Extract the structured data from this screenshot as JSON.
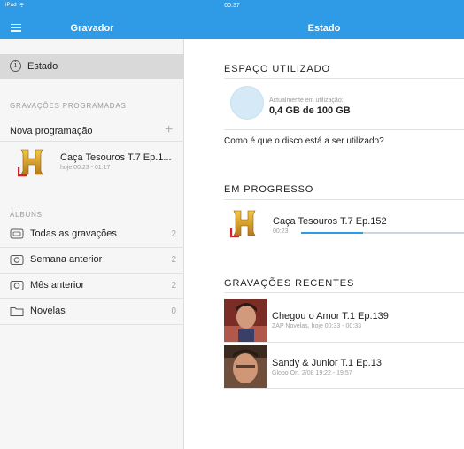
{
  "status_bar": {
    "device": "iPad",
    "wifi": "wifi-icon",
    "time": "00:37"
  },
  "nav": {
    "left_title": "Gravador",
    "right_title": "Estado",
    "accent": "#2f9ae6"
  },
  "sidebar": {
    "selected_label": "Estado",
    "scheduled_header": "GRAVAÇÕES PROGRAMADAS",
    "new_schedule_label": "Nova programação",
    "scheduled": [
      {
        "title": "Caça Tesouros T.7 Ep.1...",
        "time": "hoje 00:23 - 01:17",
        "icon": "history-channel-logo"
      }
    ],
    "albums_header": "ÁLBUNS",
    "albums": [
      {
        "label": "Todas as gravações",
        "count": "2",
        "icon": "tv-icon"
      },
      {
        "label": "Semana anterior",
        "count": "2",
        "icon": "camera-icon"
      },
      {
        "label": "Mês anterior",
        "count": "2",
        "icon": "camera-icon"
      },
      {
        "label": "Novelas",
        "count": "0",
        "icon": "folder-icon"
      }
    ]
  },
  "main": {
    "space_header": "ESPAÇO UTILIZADO",
    "usage_label": "Actualmente em utilização:",
    "usage_value": "0,4 GB de 100 GB",
    "disk_question": "Como é que o disco está a ser utilizado?",
    "progress_header": "EM PROGRESSO",
    "in_progress": {
      "title": "Caça Tesouros T.7 Ep.152",
      "time": "00:23",
      "progress": 0.38
    },
    "recent_header": "GRAVAÇÕES RECENTES",
    "recent": [
      {
        "title": "Chegou o Amor T.1 Ep.139",
        "sub": "ZAP Novelas, hoje 00:33 - 00:33"
      },
      {
        "title": "Sandy & Junior T.1 Ep.13",
        "sub": "Globo On, 2/08 19:22 - 19:57"
      }
    ]
  }
}
